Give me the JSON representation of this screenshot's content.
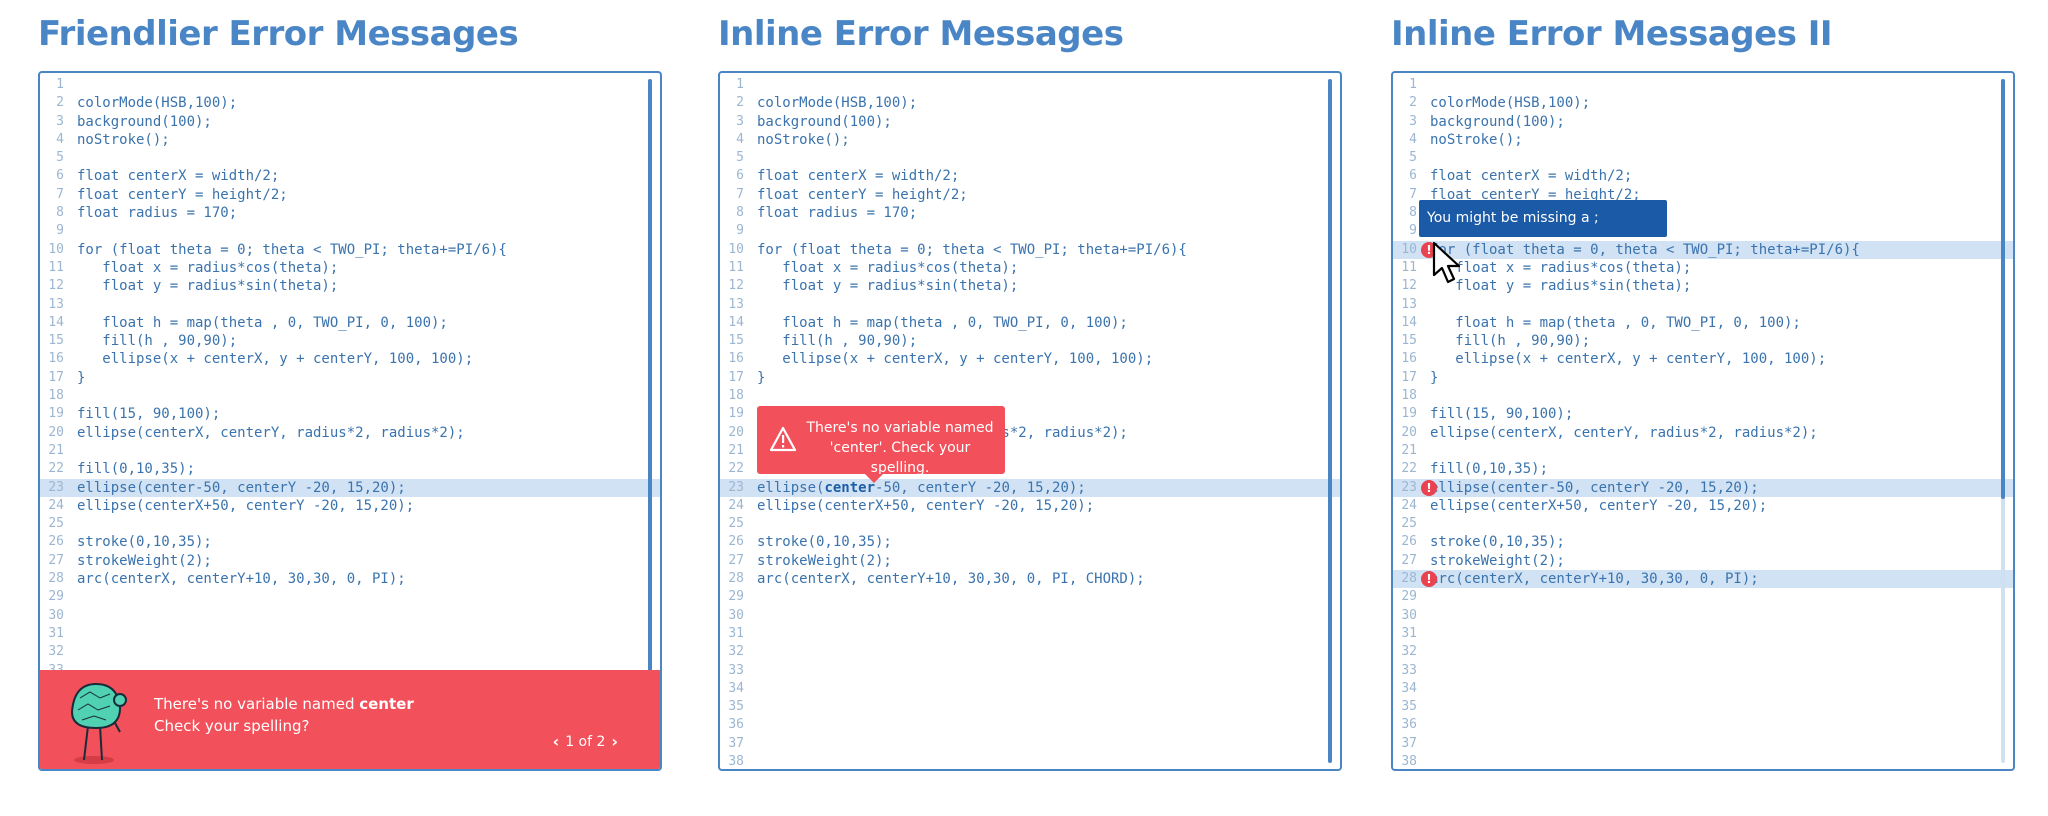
{
  "panels": [
    {
      "title": "Friendlier Error Messages",
      "line_numbers": [
        "1",
        "2",
        "3",
        "4",
        "5",
        "6",
        "7",
        "8",
        "9",
        "10",
        "11",
        "12",
        "13",
        "14",
        "15",
        "16",
        "17",
        "18",
        "19",
        "20",
        "21",
        "22",
        "23",
        "24",
        "25",
        "26",
        "27",
        "28",
        "29",
        "30",
        "31",
        "32",
        "33"
      ],
      "code": [
        "",
        "colorMode(HSB,100);",
        "background(100);",
        "noStroke();",
        "",
        "float centerX = width/2;",
        "float centerY = height/2;",
        "float radius = 170;",
        "",
        "for (float theta = 0; theta < TWO_PI; theta+=PI/6){",
        "   float x = radius*cos(theta);",
        "   float y = radius*sin(theta);",
        "",
        "   float h = map(theta , 0, TWO_PI, 0, 100);",
        "   fill(h , 90,90);",
        "   ellipse(x + centerX, y + centerY, 100, 100);",
        "}",
        "",
        "fill(15, 90,100);",
        "ellipse(centerX, centerY, radius*2, radius*2);",
        "",
        "fill(0,10,35);",
        "ellipse(center-50, centerY -20, 15,20);",
        "ellipse(centerX+50, centerY -20, 15,20);",
        "",
        "stroke(0,10,35);",
        "strokeWeight(2);",
        "arc(centerX, centerY+10, 30,30, 0, PI);",
        "",
        "",
        "",
        "",
        ""
      ],
      "error_bar": {
        "message_prefix": "There's no variable named ",
        "variable": "center",
        "hint": "Check your spelling?",
        "pager_text": "1 of 2"
      }
    },
    {
      "title": "Inline Error Messages",
      "line_numbers": [
        "1",
        "2",
        "3",
        "4",
        "5",
        "6",
        "7",
        "8",
        "9",
        "10",
        "11",
        "12",
        "13",
        "14",
        "15",
        "16",
        "17",
        "18",
        "19",
        "20",
        "21",
        "22",
        "23",
        "24",
        "25",
        "26",
        "27",
        "28",
        "29",
        "30",
        "31",
        "32",
        "33",
        "34",
        "35",
        "36",
        "37",
        "38"
      ],
      "code": [
        "",
        "colorMode(HSB,100);",
        "background(100);",
        "noStroke();",
        "",
        "float centerX = width/2;",
        "float centerY = height/2;",
        "float radius = 170;",
        "",
        "for (float theta = 0; theta < TWO_PI; theta+=PI/6){",
        "   float x = radius*cos(theta);",
        "   float y = radius*sin(theta);",
        "",
        "   float h = map(theta , 0, TWO_PI, 0, 100);",
        "   fill(h , 90,90);",
        "   ellipse(x + centerX, y + centerY, 100, 100);",
        "}",
        "",
        "",
        "                           ius*2, radius*2);",
        "",
        "",
        "",
        "ellipse(centerX+50, centerY -20, 15,20);",
        "",
        "stroke(0,10,35);",
        "strokeWeight(2);",
        "arc(centerX, centerY+10, 30,30, 0, PI, CHORD);",
        "",
        "",
        "",
        "",
        "",
        "",
        "",
        "",
        "",
        ""
      ],
      "error_line": {
        "prefix": "ellipse(",
        "variable": "center",
        "suffix": "-50, centerY -20, 15,20);"
      },
      "popup": {
        "line1": "There's no variable named",
        "line2": "'center'. Check your spelling."
      }
    },
    {
      "title": "Inline Error Messages II",
      "line_numbers": [
        "1",
        "2",
        "3",
        "4",
        "5",
        "6",
        "7",
        "8",
        "9",
        "10",
        "11",
        "12",
        "13",
        "14",
        "15",
        "16",
        "17",
        "18",
        "19",
        "20",
        "21",
        "22",
        "23",
        "24",
        "25",
        "26",
        "27",
        "28",
        "29",
        "30",
        "31",
        "32",
        "33",
        "34",
        "35",
        "36",
        "37",
        "38"
      ],
      "code": [
        "",
        "colorMode(HSB,100);",
        "background(100);",
        "noStroke();",
        "",
        "float centerX = width/2;",
        "float centerY = height/2;",
        "",
        "",
        "for (float theta = 0, theta < TWO_PI; theta+=PI/6){",
        "   float x = radius*cos(theta);",
        "   float y = radius*sin(theta);",
        "",
        "   float h = map(theta , 0, TWO_PI, 0, 100);",
        "   fill(h , 90,90);",
        "   ellipse(x + centerX, y + centerY, 100, 100);",
        "}",
        "",
        "fill(15, 90,100);",
        "ellipse(centerX, centerY, radius*2, radius*2);",
        "",
        "fill(0,10,35);",
        "ellipse(center-50, centerY -20, 15,20);",
        "ellipse(centerX+50, centerY -20, 15,20);",
        "",
        "stroke(0,10,35);",
        "strokeWeight(2);",
        "arc(centerX, centerY+10, 30,30, 0, PI);",
        "",
        "",
        "",
        "",
        "",
        "",
        "",
        "",
        "",
        ""
      ],
      "tooltip": "You might be missing a ;",
      "error_icon_glyph": "!"
    }
  ],
  "colors": {
    "title": "#4a86c5",
    "code": "#3a73ad",
    "highlight": "#d0e2f4",
    "error": "#f2505a",
    "tooltip": "#1b5aa6"
  },
  "icons": [
    "mascot-icon",
    "chevron-left-icon",
    "chevron-right-icon",
    "warning-icon",
    "error-icon",
    "cursor-icon"
  ]
}
